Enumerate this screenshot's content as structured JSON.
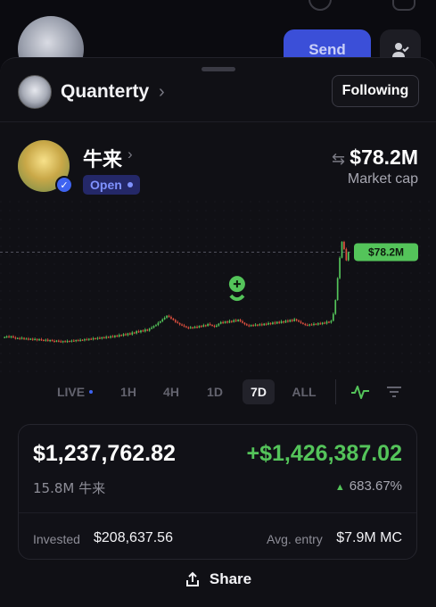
{
  "background": {
    "send_label": "Send"
  },
  "header": {
    "name": "Quanterty",
    "chevron": "›",
    "follow_label": "Following"
  },
  "token": {
    "name": "牛来",
    "chevron": "›",
    "status": "Open",
    "verified_icon": "check-badge-icon",
    "market_cap": "$78.2M",
    "market_cap_label": "Market cap",
    "swap_icon": "swap-icon"
  },
  "chart_data": {
    "type": "candlestick",
    "current_price_label": "$78.2M",
    "current_price": 78.2,
    "series": [
      {
        "name": "",
        "values": [
          14.0,
          14.5,
          13.8,
          14.6,
          13.6,
          12.9,
          13.3,
          12.6,
          13.4,
          12.5,
          12.8,
          12.2,
          12.7,
          11.9,
          12.5,
          11.6,
          12.3,
          11.8,
          11.3,
          12.0,
          11.0,
          11.7,
          11.1,
          10.6,
          11.3,
          10.8,
          10.2,
          10.9,
          10.4,
          11.0,
          10.7,
          11.3,
          10.9,
          11.7,
          11.2,
          11.9,
          11.5,
          12.3,
          11.9,
          12.7,
          12.2,
          13.1,
          12.6,
          13.4,
          12.9,
          13.8,
          13.3,
          14.2,
          13.6,
          14.6,
          14.0,
          15.1,
          14.4,
          15.6,
          15.0,
          16.2,
          15.4,
          16.8,
          15.9,
          17.5,
          16.8,
          18.4,
          17.6,
          19.0,
          18.2,
          19.7,
          18.8,
          20.3,
          21.2,
          22.4,
          23.1,
          24.8,
          25.9,
          27.4,
          28.6,
          30.1,
          29.2,
          28.0,
          26.9,
          25.4,
          24.6,
          23.5,
          22.8,
          22.1,
          21.3,
          20.7,
          21.4,
          20.9,
          21.8,
          21.2,
          22.4,
          21.9,
          23.0,
          22.4,
          23.9,
          23.2,
          22.6,
          21.8,
          22.7,
          24.1,
          25.3,
          24.6,
          25.8,
          24.9,
          26.2,
          25.4,
          26.8,
          26.0,
          27.1,
          25.9,
          24.8,
          23.7,
          22.9,
          22.3,
          23.1,
          22.6,
          23.4,
          22.8,
          23.7,
          23.0,
          24.1,
          23.4,
          24.6,
          23.8,
          25.0,
          24.2,
          25.5,
          24.6,
          25.9,
          25.0,
          26.4,
          25.6,
          27.0,
          26.1,
          27.5,
          26.5,
          25.6,
          24.7,
          23.9,
          23.2,
          22.8,
          23.6,
          23.1,
          24.0,
          23.4,
          24.4,
          23.8,
          24.9,
          24.2,
          25.6,
          24.9,
          26.3,
          31.5,
          42.0,
          58.5,
          74.0,
          86.0,
          80.5,
          72.0,
          78.2
        ]
      }
    ]
  },
  "timeframes": [
    {
      "label": "LIVE",
      "active": false
    },
    {
      "label": "1H",
      "active": false
    },
    {
      "label": "4H",
      "active": false
    },
    {
      "label": "1D",
      "active": false
    },
    {
      "label": "7D",
      "active": true
    },
    {
      "label": "ALL",
      "active": false
    }
  ],
  "position": {
    "value": "$1,237,762.82",
    "pnl": "+$1,426,387.02",
    "amount": "15.8M 牛来",
    "pnl_pct": "683.67%",
    "invested_label": "Invested",
    "invested_value": "$208,637.56",
    "avg_entry_label": "Avg. entry",
    "avg_entry_value": "$7.9M MC"
  },
  "share_label": "Share",
  "colors": {
    "green": "#54c45a",
    "red": "#e0503f",
    "accent_blue": "#3e63f0",
    "sheet_bg": "#101015"
  }
}
